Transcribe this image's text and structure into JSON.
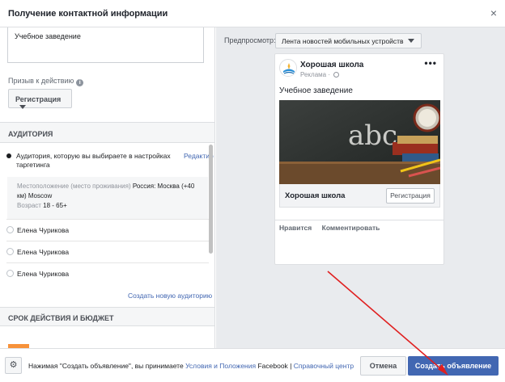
{
  "header": {
    "title": "Получение контактной информации",
    "close_glyph": "×"
  },
  "left": {
    "text_value": "Учебное заведение",
    "cta_label": "Призыв к действию",
    "cta_value": "Регистрация",
    "audience_section": "АУДИТОРИЯ",
    "audience_option_text": "Аудитория, которую вы выбираете в настройках таргетинга",
    "edit_link": "Редактир",
    "details": {
      "location_label": "Местоположение (место проживания)",
      "location_value": "Россия: Москва (+40 км) Moscow",
      "age_label": "Возраст",
      "age_value": "18 - 65+"
    },
    "saved_audiences": [
      "Елена Чурикова",
      "Елена Чурикова",
      "Елена Чурикова"
    ],
    "create_audience_link": "Создать новую аудиторию",
    "budget_section": "СРОК ДЕЙСТВИЯ И БЮДЖЕТ"
  },
  "preview": {
    "label": "Предпросмотр:",
    "placement": "Лента новостей мобильных устройств",
    "page_name": "Хорошая школа",
    "sponsored": "Реклама",
    "sponsored_separator": "·",
    "post_text": "Учебное заведение",
    "headline": "Хорошая школа",
    "button": "Регистрация",
    "actions": [
      "Нравится",
      "Комментировать"
    ]
  },
  "footer": {
    "text_before": "Нажимая \"Создать объявление\", вы принимаете",
    "terms_link": "Условия и Положения",
    "text_after": "Facebook",
    "separator": "|",
    "help_link": "Справочный центр",
    "cancel_label": "Отмена",
    "create_label": "Создать объявление"
  },
  "colors": {
    "accent": "#4267b2",
    "annotation_arrow": "#e02020"
  }
}
